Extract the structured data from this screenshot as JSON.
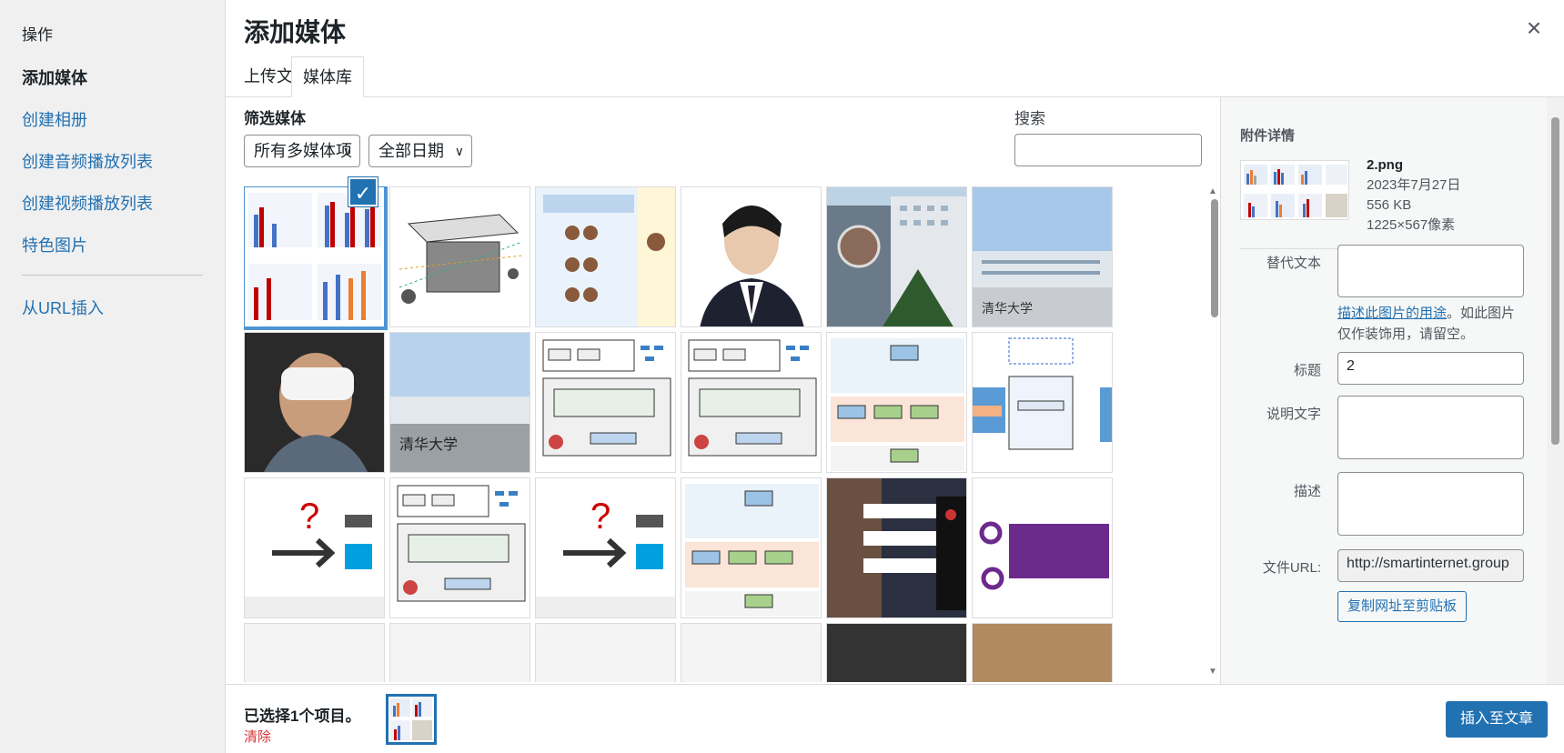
{
  "sidebar": {
    "heading": "操作",
    "items": [
      {
        "label": "添加媒体",
        "active": true
      },
      {
        "label": "创建相册",
        "active": false
      },
      {
        "label": "创建音频播放列表",
        "active": false
      },
      {
        "label": "创建视频播放列表",
        "active": false
      },
      {
        "label": "特色图片",
        "active": false
      }
    ],
    "url_insert": "从URL插入"
  },
  "modal": {
    "title": "添加媒体",
    "close": "×",
    "tabs": [
      "上传文件",
      "媒体库"
    ],
    "active_tab": "媒体库"
  },
  "filters": {
    "label": "筛选媒体",
    "type_value": "所有多媒体项",
    "date_value": "全部日期",
    "search_label": "搜索",
    "search_value": ""
  },
  "grid": {
    "tiles": [
      {
        "kind": "chart-figure",
        "selected": true
      },
      {
        "kind": "diagram-drones",
        "selected": false
      },
      {
        "kind": "diagram-faces",
        "selected": false
      },
      {
        "kind": "portrait-man",
        "selected": false
      },
      {
        "kind": "photo-building",
        "selected": false
      },
      {
        "kind": "photo-campus",
        "selected": false
      },
      {
        "kind": "photo-vr",
        "selected": false
      },
      {
        "kind": "photo-campus-sign",
        "selected": false
      },
      {
        "kind": "diagram-training",
        "selected": false
      },
      {
        "kind": "diagram-training",
        "selected": false
      },
      {
        "kind": "diagram-pipeline",
        "selected": false
      },
      {
        "kind": "diagram-cdn",
        "selected": false
      },
      {
        "kind": "diagram-fit",
        "selected": false
      },
      {
        "kind": "diagram-training",
        "selected": false
      },
      {
        "kind": "diagram-fit",
        "selected": false
      },
      {
        "kind": "diagram-pipeline",
        "selected": false
      },
      {
        "kind": "photo-robot",
        "selected": false
      },
      {
        "kind": "logo-purple",
        "selected": false
      }
    ]
  },
  "details": {
    "title": "附件详情",
    "filename": "2.png",
    "date": "2023年7月27日",
    "size": "556 KB",
    "dimensions": "1225×567像素",
    "alt_label": "替代文本",
    "alt_value": "",
    "help_link": "描述此图片的用途",
    "help_rest": "。如此图片仅作装饰用，请留空。",
    "title_label": "标题",
    "title_value": "2",
    "caption_label": "说明文字",
    "caption_value": "",
    "desc_label": "描述",
    "desc_value": "",
    "url_label": "文件URL:",
    "url_value": "http://smartinternet.group",
    "copy_button": "复制网址至剪贴板"
  },
  "footer": {
    "selected_text": "已选择1个项目。",
    "clear": "清除",
    "insert_button": "插入至文章"
  },
  "colors": {
    "accent": "#2271b1",
    "danger": "#d63638",
    "sidebar_bg": "#f0f0f1"
  }
}
